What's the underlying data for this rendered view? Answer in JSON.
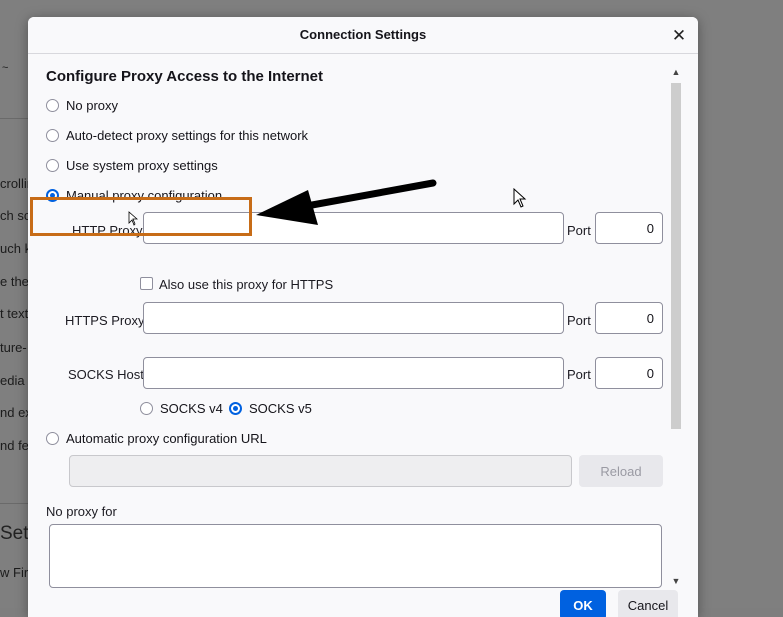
{
  "background_page": {
    "fragments": [
      "crollin",
      "ch scr",
      "uch k",
      "e the",
      "t text",
      "ture-",
      "edia y",
      "nd ex",
      "nd fe",
      "Setti",
      "w Fire",
      "~"
    ]
  },
  "dialog": {
    "title": "Connection Settings",
    "close_label": "✕",
    "heading": "Configure Proxy Access to the Internet",
    "options": {
      "no_proxy": "No proxy",
      "auto_detect": "Auto-detect proxy settings for this network",
      "system": "Use system proxy settings",
      "manual": "Manual proxy configuration",
      "pac": "Automatic proxy configuration URL"
    },
    "selected_option": "manual",
    "manual": {
      "http_proxy_label": "HTTP Proxy",
      "http_proxy_value": "",
      "http_port_label": "Port",
      "http_port_value": "0",
      "also_https_label": "Also use this proxy for HTTPS",
      "also_https_checked": false,
      "https_proxy_label": "HTTPS Proxy",
      "https_proxy_value": "",
      "https_port_label": "Port",
      "https_port_value": "0",
      "socks_host_label": "SOCKS Host",
      "socks_host_value": "",
      "socks_port_label": "Port",
      "socks_port_value": "0",
      "socks_v4_label": "SOCKS v4",
      "socks_v5_label": "SOCKS v5",
      "socks_version_selected": "v5"
    },
    "pac": {
      "url_value": "",
      "reload_label": "Reload"
    },
    "no_proxy_for_label": "No proxy for",
    "no_proxy_for_value": "",
    "ok_label": "OK",
    "cancel_label": "Cancel"
  },
  "annotation": {
    "highlight_color": "#c76c17",
    "arrow_color": "#000000"
  },
  "colors": {
    "accent": "#0061e0",
    "dialog_bg": "#f9f9fb",
    "overlay": "#7f7f7f"
  }
}
